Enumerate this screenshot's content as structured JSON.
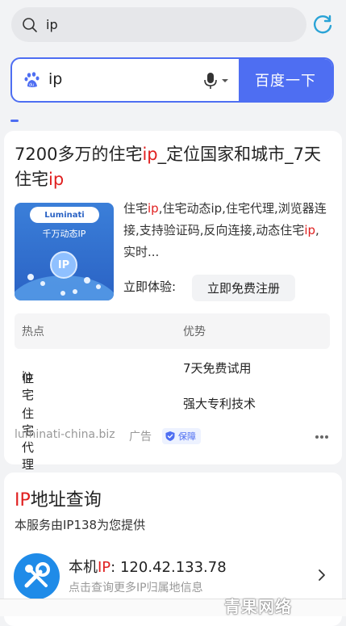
{
  "topbar": {
    "query": "ip",
    "search_icon": "search-icon",
    "refresh_icon": "refresh-icon"
  },
  "searchbox": {
    "query": "ip",
    "button": "百度一下",
    "logo_icon": "baidu-paw-icon",
    "voice_icon": "microphone-icon"
  },
  "result1": {
    "title_parts": [
      "7200多万的住宅",
      "ip",
      "_定位国家和城市_7天住宅",
      "ip"
    ],
    "thumb": {
      "brand": "Luminati",
      "slogan": "千万动态IP",
      "badge": "IP"
    },
    "desc_parts": [
      "住宅",
      "ip",
      ",住宅动态ip,住宅代理,浏览器连接,支持验证码,反向连接,动态住宅",
      "ip",
      ",实时..."
    ],
    "try_label": "立即体验:",
    "register_button": "立即免费注册",
    "table": {
      "headers": [
        "热点",
        "优势"
      ],
      "rows": [
        {
          "c1_main": "住宅",
          "c1_hl": "ip",
          "c2": "7天免费试用"
        },
        {
          "c1_main": "住宅代理",
          "c1_hl": "",
          "c2": "强大专利技术"
        }
      ]
    },
    "source": "luminati-china.biz",
    "ad_label": "广告",
    "guard_label": "保障"
  },
  "result2": {
    "title_hl": "IP",
    "title_rest": "地址查询",
    "subtitle": "本服务由IP138为您提供",
    "ip_label_pre": "本机",
    "ip_label_hl": "IP",
    "ip_label_post": ":",
    "ip_value": "120.42.133.78",
    "hint": "点击查询更多IP归属地信息"
  },
  "watermark": "青果网络",
  "colors": {
    "accent": "#4e6ef2",
    "highlight": "#e02020"
  }
}
